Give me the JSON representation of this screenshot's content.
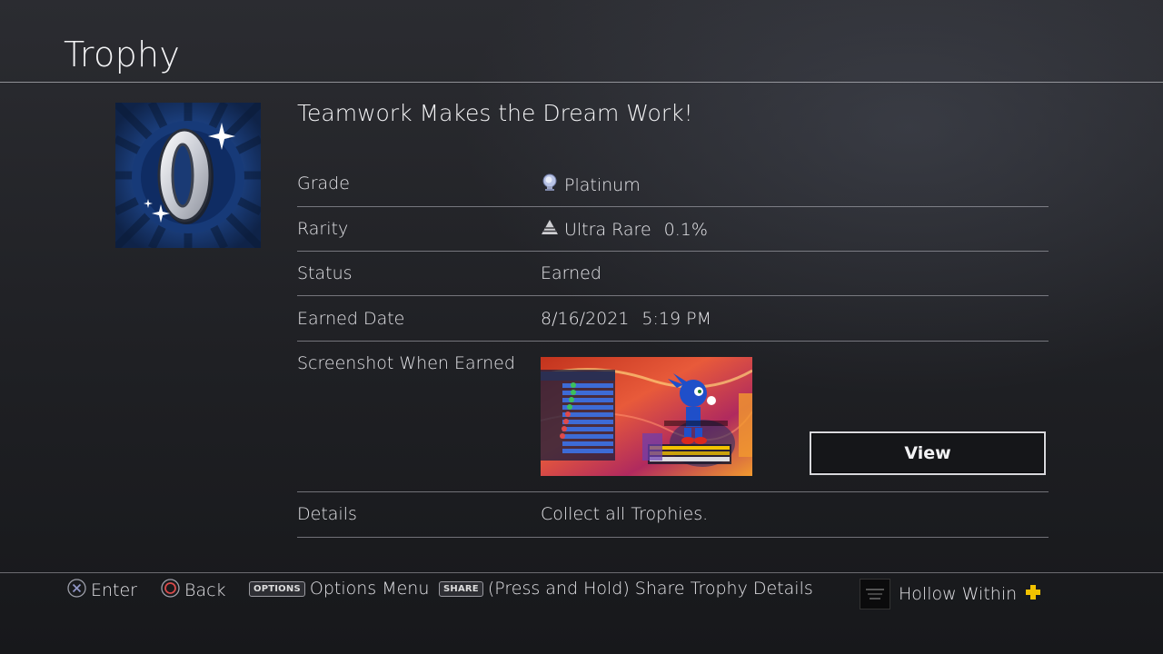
{
  "header": {
    "title": "Trophy"
  },
  "trophy": {
    "name": "Teamwork Makes the Dream Work!",
    "rows": {
      "grade": {
        "label": "Grade",
        "value": "Platinum",
        "icon": "platinum-trophy-icon"
      },
      "rarity": {
        "label": "Rarity",
        "value": "Ultra Rare",
        "percent": "0.1%",
        "icon": "rarity-pyramid-icon"
      },
      "status": {
        "label": "Status",
        "value": "Earned"
      },
      "earned_date": {
        "label": "Earned Date",
        "date": "8/16/2021",
        "time": "5:19 PM"
      },
      "screenshot": {
        "label": "Screenshot When Earned",
        "view_label": "View"
      },
      "details": {
        "label": "Details",
        "value": "Collect all Trophies."
      }
    }
  },
  "footer": {
    "enter": {
      "label": "Enter",
      "icon": "cross-button-icon"
    },
    "back": {
      "label": "Back",
      "icon": "circle-button-icon"
    },
    "options": {
      "chip": "OPTIONS",
      "label": "Options Menu"
    },
    "share": {
      "chip": "SHARE",
      "label": "(Press and Hold) Share Trophy Details"
    },
    "user": {
      "name": "Hollow Within",
      "plus_icon": "ps-plus-icon"
    }
  },
  "colors": {
    "plus_gold": "#f2c200",
    "cross_button": "#8f95c4",
    "circle_button": "#d84a4a",
    "rarity_bronze": "#c9c9cc"
  }
}
